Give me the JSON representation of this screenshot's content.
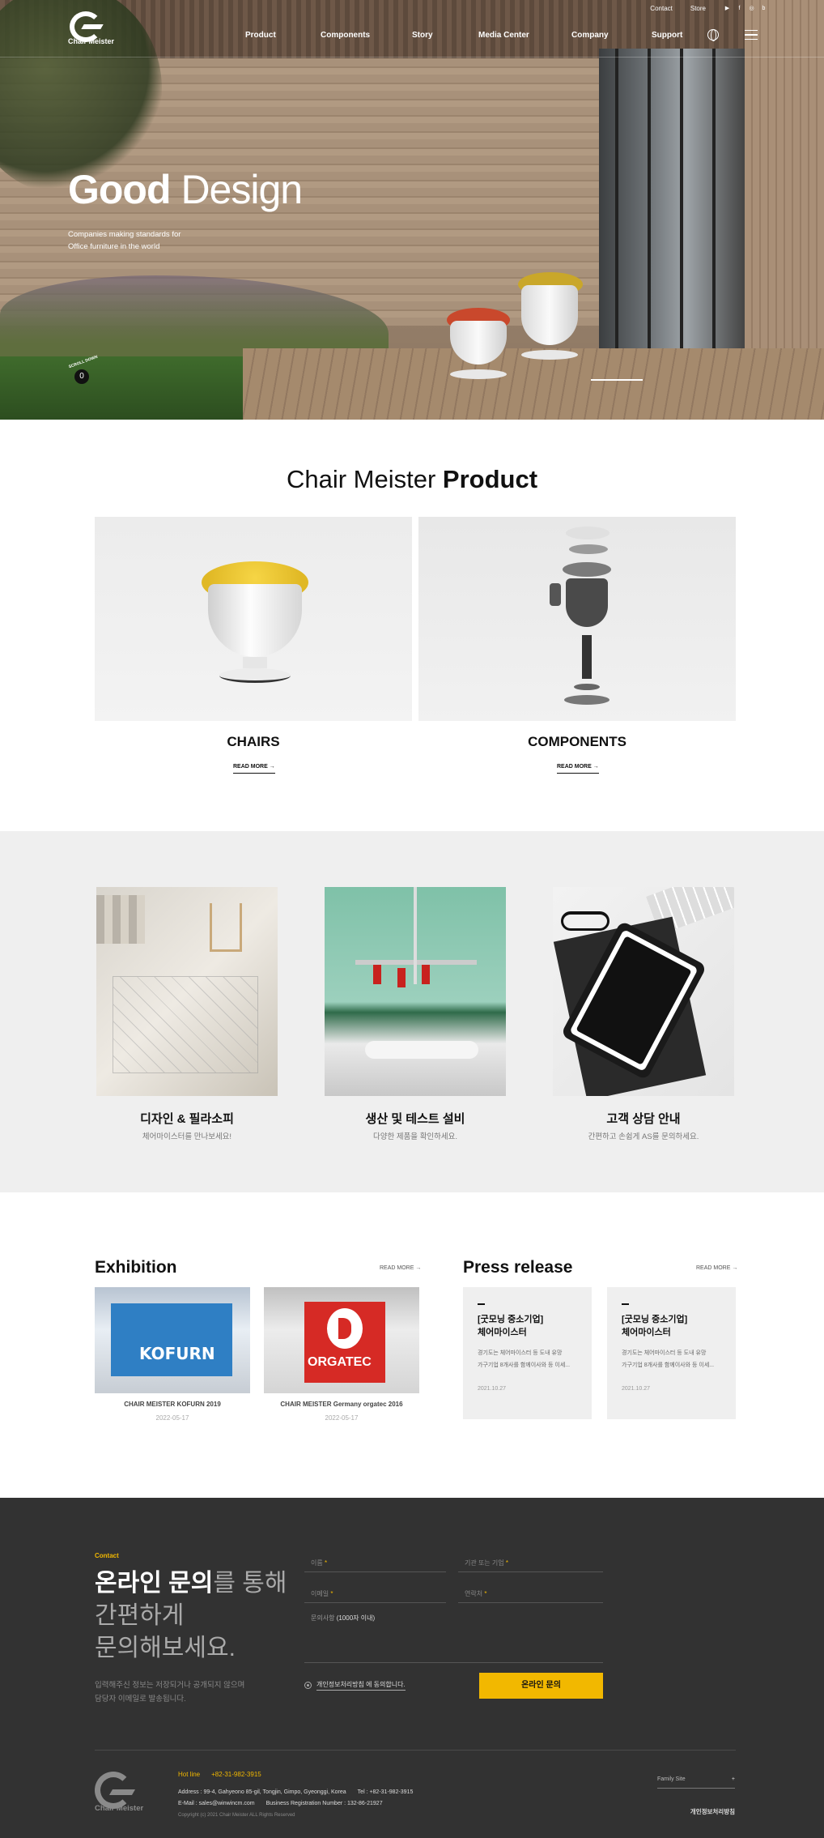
{
  "header": {
    "logo_text": "Chair Meister",
    "utility": [
      "Contact",
      "Store"
    ],
    "social": [
      "youtube-icon",
      "facebook-icon",
      "instagram-icon",
      "blog-icon"
    ],
    "menu": [
      "Product",
      "Components",
      "Story",
      "Media Center",
      "Company",
      "Support"
    ]
  },
  "hero": {
    "title_bold": "Good",
    "title_light": "Design",
    "subtitle_line1": "Companies making standards for",
    "subtitle_line2": "Office furniture in the world",
    "scroll_label": "SCROLL DOWN",
    "slide_number": "0"
  },
  "product": {
    "title_light": "Chair Meister",
    "title_bold": "Product",
    "cards": [
      {
        "name": "CHAIRS",
        "link": "READ MORE →"
      },
      {
        "name": "COMPONENTS",
        "link": "READ MORE →"
      }
    ]
  },
  "features": [
    {
      "title": "디자인 & 필라소피",
      "desc": "체어마이스터를 만나보세요!"
    },
    {
      "title": "생산 및 테스트 설비",
      "desc": "다양한 제품을 확인하세요."
    },
    {
      "title": "고객 상담 안내",
      "desc": "간편하고 손쉽게 AS를 문의하세요."
    }
  ],
  "exhibition": {
    "heading": "Exhibition",
    "more": "READ MORE →",
    "items": [
      {
        "caption": "CHAIR MEISTER KOFURN 2019",
        "date": "2022-05-17",
        "booth_text": "KOFURN"
      },
      {
        "caption": "CHAIR MEISTER Germany orgatec 2016",
        "date": "2022-05-17",
        "booth_text": "ORGATEC"
      }
    ]
  },
  "press": {
    "heading": "Press release",
    "more": "READ MORE →",
    "items": [
      {
        "title_line1": "[굿모닝 중소기업]",
        "title_line2": "체어마이스터",
        "desc_line1": "경기도는 체어마이스터 등 도내 유망",
        "desc_line2": "가구기업 8개사를 함께이사와 등 이세...",
        "date": "2021.10.27"
      },
      {
        "title_line1": "[굿모닝 중소기업]",
        "title_line2": "체어마이스터",
        "desc_line1": "경기도는 체어마이스터 등 도내 유망",
        "desc_line2": "가구기업 8개사를 함께이사와 등 이세...",
        "date": "2021.10.27"
      }
    ]
  },
  "contact": {
    "tag": "Contact",
    "head_bold": "온라인 문의",
    "head_rest1": "를 통해",
    "head_rest2": "간편하게",
    "head_rest3": "문의해보세요.",
    "note_line1": "입력해주신 정보는 저장되거나 공개되지 않으며",
    "note_line2": "담당자 이메일로 발송됩니다.",
    "fields": {
      "name": "이름",
      "company": "기관 또는 기업",
      "email": "이메일",
      "phone": "연락처",
      "required_mark": "*"
    },
    "message_label": "문의사항",
    "message_limit": "(1000자 이내)",
    "agree_text": "개인정보처리방침 에 동의합니다.",
    "submit": "온라인 문의"
  },
  "footer": {
    "logo_text": "Chair Meister",
    "hotline_label": "Hot line",
    "hotline_number": "+82-31-982-3915",
    "address": "Address : 99-4, Gahyeono 85-gil, Tongjin, Gimpo, Gyeonggi, Korea",
    "tel": "Tel : +82-31-982-3915",
    "email": "E-Mail : sales@winwincm.com",
    "business_no": "Business Registration Number : 132-86-21927",
    "copyright": "Copyright (c) 2021 Chair Meister ALL Rights Reserved",
    "family_site": "Family Site",
    "family_plus": "+",
    "privacy": "개인정보처리방침"
  },
  "colors": {
    "accent": "#f2b800",
    "dark_bg": "#323232",
    "grey_bg": "#efefef"
  }
}
